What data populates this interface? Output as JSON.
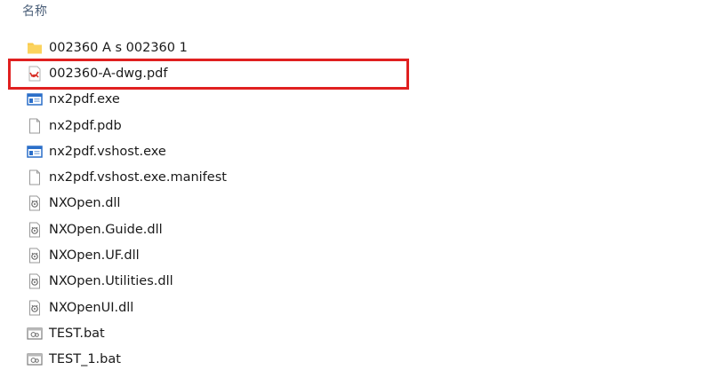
{
  "column_header": {
    "name_label": "名称"
  },
  "files": [
    {
      "name": "002360   A   s 002360  1",
      "icon": "folder-icon"
    },
    {
      "name": "002360-A-dwg.pdf",
      "icon": "pdf-icon"
    },
    {
      "name": "nx2pdf.exe",
      "icon": "exe-icon"
    },
    {
      "name": "nx2pdf.pdb",
      "icon": "file-icon"
    },
    {
      "name": "nx2pdf.vshost.exe",
      "icon": "exe-icon"
    },
    {
      "name": "nx2pdf.vshost.exe.manifest",
      "icon": "file-icon"
    },
    {
      "name": "NXOpen.dll",
      "icon": "dll-icon"
    },
    {
      "name": "NXOpen.Guide.dll",
      "icon": "dll-icon"
    },
    {
      "name": "NXOpen.UF.dll",
      "icon": "dll-icon"
    },
    {
      "name": "NXOpen.Utilities.dll",
      "icon": "dll-icon"
    },
    {
      "name": "NXOpenUI.dll",
      "icon": "dll-icon"
    },
    {
      "name": "TEST.bat",
      "icon": "bat-icon"
    },
    {
      "name": "TEST_1.bat",
      "icon": "bat-icon"
    }
  ],
  "highlight": {
    "color": "#e02020",
    "target": "002360-A-dwg.pdf"
  },
  "colors": {
    "folder": "#f8c94a",
    "pdf_red": "#d8322a",
    "exe_blue": "#2b6fc9",
    "header_text": "#4c607a"
  }
}
